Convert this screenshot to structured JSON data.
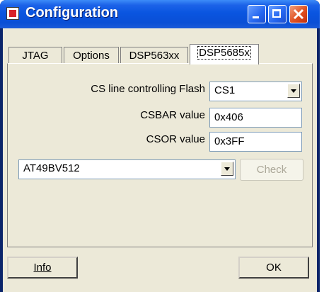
{
  "window": {
    "title": "Configuration"
  },
  "tabs": [
    {
      "label": "JTAG"
    },
    {
      "label": "Options"
    },
    {
      "label": "DSP563xx"
    },
    {
      "label": "DSP5685x",
      "active": true
    }
  ],
  "form": {
    "cs_line": {
      "label": "CS line controlling Flash",
      "value": "CS1"
    },
    "csbar": {
      "label": "CSBAR value",
      "value": "0x406"
    },
    "csor": {
      "label": "CSOR value",
      "value": "0x3FF"
    },
    "device": {
      "value": "AT49BV512"
    },
    "check_label": "Check"
  },
  "buttons": {
    "info_label": "Info",
    "ok_label": "OK"
  },
  "colors": {
    "titlebar": "#0a55e0",
    "face": "#ece9d8",
    "close": "#e05020"
  }
}
